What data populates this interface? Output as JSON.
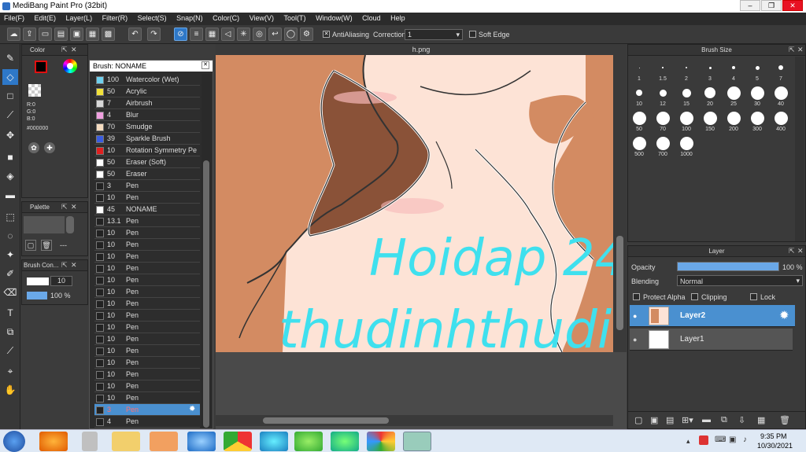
{
  "window": {
    "title": "MediBang Paint Pro (32bit)"
  },
  "menu": [
    "File(F)",
    "Edit(E)",
    "Layer(L)",
    "Filter(R)",
    "Select(S)",
    "Snap(N)",
    "Color(C)",
    "View(V)",
    "Tool(T)",
    "Window(W)",
    "Cloud",
    "Help"
  ],
  "toolbar": {
    "antialiasing": "AntiAliasing",
    "correction_label": "Correction",
    "correction_value": "1",
    "soft_edge": "Soft Edge"
  },
  "color_panel": {
    "title": "Color",
    "r": "R:0",
    "g": "G:0",
    "b": "B:0",
    "hex": "#000000"
  },
  "palette_panel": {
    "title": "Palette",
    "more": "---"
  },
  "brush_control": {
    "title": "Brush Con...",
    "size": "10",
    "opacity": "100 %"
  },
  "brush_list": {
    "title": "Brush: NONAME",
    "items": [
      {
        "size": "100",
        "name": "Watercolor (Wet)",
        "color": "#6ed0ee"
      },
      {
        "size": "50",
        "name": "Acrylic",
        "color": "#f2e13a"
      },
      {
        "size": "7",
        "name": "Airbrush",
        "color": "#d8d8d8"
      },
      {
        "size": "4",
        "name": "Blur",
        "color": "#f0a0e0"
      },
      {
        "size": "70",
        "name": "Smudge",
        "color": "#f6dcc0"
      },
      {
        "size": "39",
        "name": "Sparkle Brush",
        "color": "#3a5ce0"
      },
      {
        "size": "10",
        "name": "Rotation Symmetry Pe",
        "color": "#e02020"
      },
      {
        "size": "50",
        "name": "Eraser (Soft)",
        "color": "#ffffff"
      },
      {
        "size": "50",
        "name": "Eraser",
        "color": "#ffffff"
      },
      {
        "size": "3",
        "name": "Pen",
        "color": "#222222"
      },
      {
        "size": "10",
        "name": "Pen",
        "color": "#222222"
      },
      {
        "size": "45",
        "name": "NONAME",
        "color": "#ffffff"
      },
      {
        "size": "13.1",
        "name": "Pen",
        "color": "#222222"
      },
      {
        "size": "10",
        "name": "Pen",
        "color": "#222222"
      },
      {
        "size": "10",
        "name": "Pen",
        "color": "#222222"
      },
      {
        "size": "10",
        "name": "Pen",
        "color": "#222222"
      },
      {
        "size": "10",
        "name": "Pen",
        "color": "#222222"
      },
      {
        "size": "10",
        "name": "Pen",
        "color": "#222222"
      },
      {
        "size": "10",
        "name": "Pen",
        "color": "#222222"
      },
      {
        "size": "10",
        "name": "Pen",
        "color": "#222222"
      },
      {
        "size": "10",
        "name": "Pen",
        "color": "#222222"
      },
      {
        "size": "10",
        "name": "Pen",
        "color": "#222222"
      },
      {
        "size": "10",
        "name": "Pen",
        "color": "#222222"
      },
      {
        "size": "10",
        "name": "Pen",
        "color": "#222222"
      },
      {
        "size": "10",
        "name": "Pen",
        "color": "#222222"
      },
      {
        "size": "10",
        "name": "Pen",
        "color": "#222222"
      },
      {
        "size": "10",
        "name": "Pen",
        "color": "#222222"
      },
      {
        "size": "10",
        "name": "Pen",
        "color": "#222222"
      },
      {
        "size": "3",
        "name": "Pen",
        "color": "#222222",
        "selected": true
      },
      {
        "size": "4",
        "name": "Pen",
        "color": "#222222"
      }
    ]
  },
  "canvas": {
    "tab": "h.png",
    "text1": "Hoidap 24",
    "text2": "thudinhthudin"
  },
  "brush_size": {
    "title": "Brush Size",
    "sizes": [
      "1",
      "1.5",
      "2",
      "3",
      "4",
      "5",
      "7",
      "10",
      "12",
      "15",
      "20",
      "25",
      "30",
      "40",
      "50",
      "70",
      "100",
      "150",
      "200",
      "300",
      "400",
      "500",
      "700",
      "1000"
    ]
  },
  "layer_panel": {
    "title": "Layer",
    "opacity_label": "Opacity",
    "opacity_value": "100 %",
    "opacity_fraction": 1.0,
    "blending_label": "Blending",
    "blending_value": "Normal",
    "protect_alpha": "Protect Alpha",
    "clipping": "Clipping",
    "lock": "Lock",
    "layers": [
      {
        "name": "Layer2",
        "selected": true
      },
      {
        "name": "Layer1",
        "selected": false
      }
    ]
  },
  "taskbar": {
    "time": "9:35 PM",
    "date": "10/30/2021"
  },
  "colors": {
    "accent": "#2e78c8",
    "skin": "#fde3d6",
    "hair": "#d38b62",
    "dark_hair": "#8a5238",
    "cyan_text": "#3fe0ee"
  }
}
